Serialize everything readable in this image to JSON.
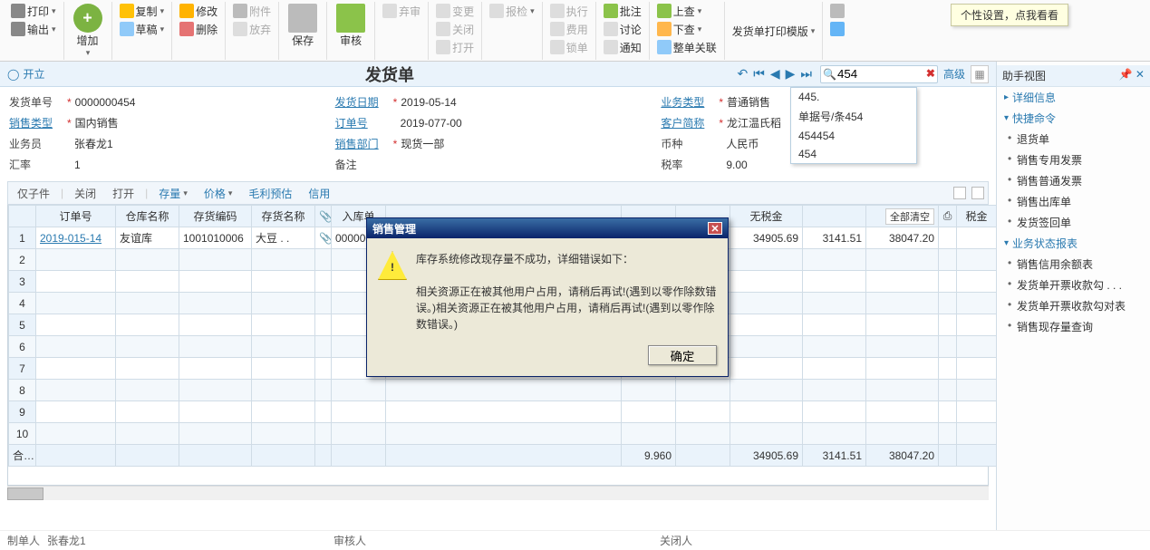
{
  "tooltip": "个性设置，点我看看",
  "toolbar": {
    "print": "打印",
    "output": "输出",
    "add": "增加",
    "copy": "复制",
    "draft": "草稿",
    "edit": "修改",
    "delete": "删除",
    "attach": "附件",
    "discard": "放弃",
    "save": "保存",
    "audit": "审核",
    "abandon": "弃审",
    "change": "变更",
    "close": "关闭",
    "open": "打开",
    "submit": "报检",
    "exec": "执行",
    "cost": "费用",
    "lock": "锁单",
    "approve": "批注",
    "discuss": "讨论",
    "notify": "通知",
    "up": "上查",
    "down": "下查",
    "relate": "整单关联",
    "template": "发货单打印模版"
  },
  "titlebar": {
    "status": "开立",
    "title": "发货单",
    "search_value": "454",
    "adv": "高级"
  },
  "dropdown": [
    "445.",
    "单据号/条454",
    "454454",
    "454"
  ],
  "form": {
    "doc_no_lbl": "发货单号",
    "doc_no": "0000000454",
    "sale_type_lbl": "销售类型",
    "sale_type": "国内销售",
    "clerk_lbl": "业务员",
    "clerk": "张春龙1",
    "rate_lbl": "汇率",
    "rate": "1",
    "date_lbl": "发货日期",
    "date": "2019-05-14",
    "order_lbl": "订单号",
    "order": "2019-077-00",
    "dept_lbl": "销售部门",
    "dept": "现货一部",
    "remark_lbl": "备注",
    "remark": "",
    "biz_lbl": "业务类型",
    "biz": "普通销售",
    "cust_lbl": "客户简称",
    "cust": "龙江温氏稻",
    "curr_lbl": "币种",
    "curr": "人民币",
    "tax_lbl": "税率",
    "tax": "9.00"
  },
  "grid_toolbar": {
    "only": "仅子件",
    "close": "关闭",
    "open": "打开",
    "stock": "存量",
    "price": "价格",
    "gross": "毛利预估",
    "credit": "信用",
    "clear_all": "全部清空"
  },
  "grid": {
    "headers": [
      "",
      "订单号",
      "仓库名称",
      "存货编码",
      "存货名称",
      "",
      "入库单",
      "",
      "",
      "",
      "无税金",
      "",
      "",
      "税金"
    ],
    "row": {
      "n": "1",
      "order": "2019-015-14",
      "wh": "友谊库",
      "code": "1001010006",
      "name": "大豆 . .",
      "inno": "000000",
      "qty": "9.960",
      "net": "34905.69",
      "tax": "3141.51",
      "total": "38047.20"
    },
    "sum_lbl": "合计",
    "sum_qty": "9.960",
    "sum_net": "34905.69",
    "sum_tax": "3141.51",
    "sum_total": "38047.20"
  },
  "footer": {
    "maker_lbl": "制单人",
    "maker": "张春龙1",
    "auditor_lbl": "审核人",
    "closer_lbl": "关闭人"
  },
  "side": {
    "title": "助手视图",
    "sec1": "详细信息",
    "sec2": "快捷命令",
    "items2": [
      "退货单",
      "销售专用发票",
      "销售普通发票",
      "销售出库单",
      "发货签回单"
    ],
    "sec3": "业务状态报表",
    "items3": [
      "销售信用余额表",
      "发货单开票收款勾 . . .",
      "发货单开票收款勾对表",
      "销售现存量查询"
    ]
  },
  "modal": {
    "title": "销售管理",
    "line1": "库存系统修改现存量不成功，详细错误如下：",
    "line2": "相关资源正在被其他用户占用，请稍后再试!(遇到以零作除数错误。)相关资源正在被其他用户占用，请稍后再试!(遇到以零作除数错误。)",
    "ok": "确定"
  }
}
